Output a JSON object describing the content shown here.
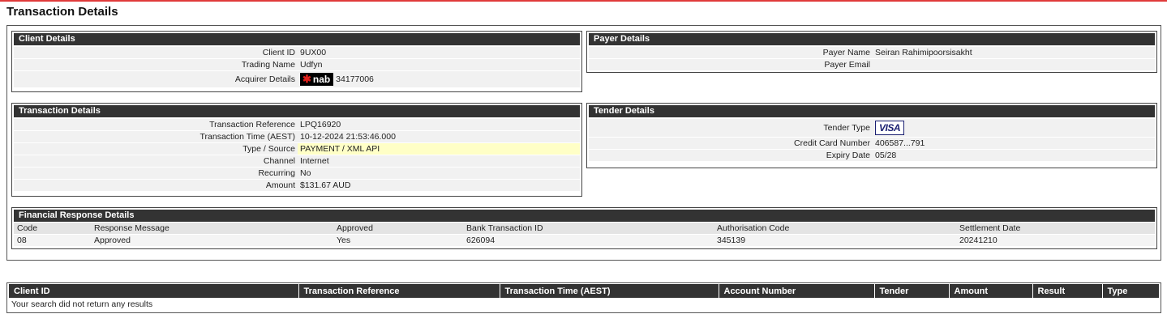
{
  "page": {
    "title": "Transaction Details"
  },
  "client_details": {
    "header": "Client Details",
    "rows": [
      {
        "label": "Client ID",
        "value": "9UX00"
      },
      {
        "label": "Trading Name",
        "value": "Udfyn"
      },
      {
        "label": "Acquirer Details",
        "value": "34177006",
        "logo_text": "nab"
      }
    ]
  },
  "payer_details": {
    "header": "Payer Details",
    "rows": [
      {
        "label": "Payer Name",
        "value": "Seiran Rahimipoorsisakht"
      },
      {
        "label": "Payer Email",
        "value": ""
      }
    ]
  },
  "transaction_details": {
    "header": "Transaction Details",
    "rows": [
      {
        "label": "Transaction Reference",
        "value": "LPQ16920"
      },
      {
        "label": "Transaction Time (AEST)",
        "value": "10-12-2024 21:53:46.000"
      },
      {
        "label": "Type / Source",
        "value": "PAYMENT / XML API"
      },
      {
        "label": "Channel",
        "value": "Internet"
      },
      {
        "label": "Recurring",
        "value": "No"
      },
      {
        "label": "Amount",
        "value": "$131.67 AUD"
      }
    ]
  },
  "tender_details": {
    "header": "Tender Details",
    "rows": [
      {
        "label": "Tender Type",
        "value": "",
        "logo_text": "VISA"
      },
      {
        "label": "Credit Card Number",
        "value": "406587...791"
      },
      {
        "label": "Expiry Date",
        "value": "05/28"
      }
    ]
  },
  "financial_response": {
    "header": "Financial Response Details",
    "columns": [
      "Code",
      "Response Message",
      "Approved",
      "Bank Transaction ID",
      "Authorisation Code",
      "Settlement Date"
    ],
    "row": [
      "08",
      "Approved",
      "Yes",
      "626094",
      "345139",
      "20241210"
    ]
  },
  "search_results": {
    "columns": [
      "Client ID",
      "Transaction Reference",
      "Transaction Time (AEST)",
      "Account Number",
      "Tender",
      "Amount",
      "Result",
      "Type"
    ],
    "empty_message": "Your search did not return any results"
  },
  "colors": {
    "accent_bar": "#e03a3a",
    "header_bg": "#333333",
    "highlight": "#ffffc6"
  }
}
